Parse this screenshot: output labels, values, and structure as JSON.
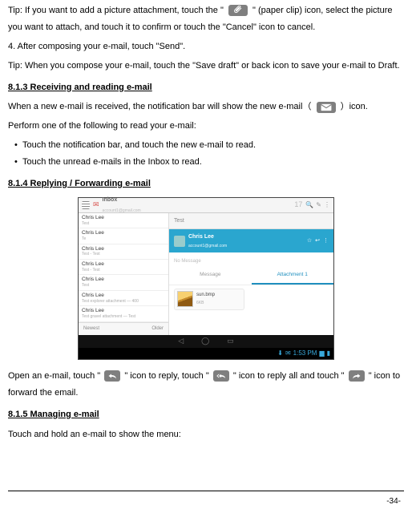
{
  "p": {
    "tip1a": "Tip: If you want to add a picture attachment, touch the \"",
    "tip1b": "\" (paper clip) icon, select the picture you want to attach, and touch it to confirm or touch the \"Cancel\" icon to cancel.",
    "step4": "4. After composing your e-mail, touch \"Send\".",
    "tip2": "Tip: When you compose your e-mail, touch the \"Save draft\" or back icon to save your e-mail to Draft.",
    "h813": "8.1.3 Receiving and reading e-mail",
    "recv_a": "When a new e-mail is received, the notification bar will show the new e-mail（",
    "recv_b": "）icon.",
    "perform": "Perform one of the following to read your e-mail:",
    "b1": "Touch the notification bar, and touch the new e-mail to read.",
    "b2": "Touch the unread e-mails in the Inbox to read.",
    "h814": "8.1.4 Replying / Forwarding e-mail",
    "open_a": "Open an e-mail, touch \"",
    "open_b": "\" icon to reply, touch \"",
    "open_c": "\" icon to reply all and touch \"",
    "open_d": "\" icon to forward the email.",
    "h815": "8.1.5 Managing e-mail",
    "manage": "Touch and hold an e-mail to show the menu:"
  },
  "shot": {
    "inbox_label": "Inbox",
    "inbox_sub": "account1@gmail.com",
    "unread_count": "17",
    "items": [
      {
        "name": "Chris Lee",
        "sub": "Test"
      },
      {
        "name": "Chris Lee",
        "sub": "Te"
      },
      {
        "name": "Chris Lee",
        "sub": "Test - Test"
      },
      {
        "name": "Chris Lee",
        "sub": "Test - Test"
      },
      {
        "name": "Chris Lee",
        "sub": "Test"
      },
      {
        "name": "Chris Lee",
        "sub": "Test explorer attachment — 400"
      },
      {
        "name": "Chris Lee",
        "sub": "Test gravel attachment — Test"
      }
    ],
    "divider_left": "Newest",
    "divider_right": "Older",
    "subject": "Test",
    "from_name": "Chris Lee",
    "from_addr": "account1@gmail.com",
    "no_message": "No Message",
    "tab_msg": "Message",
    "tab_att": "Attachment 1",
    "att_name": "sun.bmp",
    "att_size": "6KB",
    "status_time": "1:53 PM"
  },
  "page_number": "-34-"
}
